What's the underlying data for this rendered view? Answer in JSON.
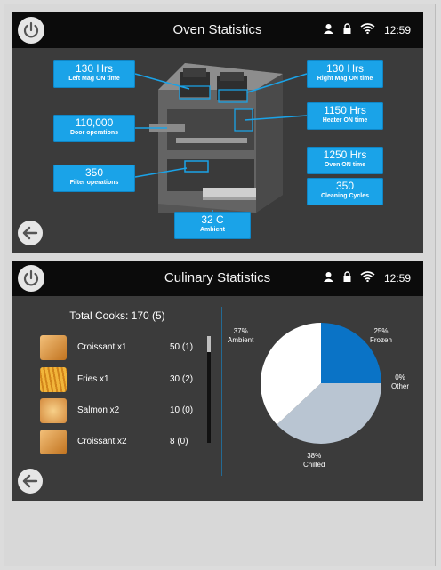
{
  "oven_panel": {
    "title": "Oven Statistics",
    "time": "12:59",
    "stats": {
      "left_mag": {
        "value": "130 Hrs",
        "label": "Left Mag ON time"
      },
      "right_mag": {
        "value": "130 Hrs",
        "label": "Right Mag ON time"
      },
      "door": {
        "value": "110,000",
        "label": "Door operations"
      },
      "heater": {
        "value": "1150 Hrs",
        "label": "Heater ON time"
      },
      "filter": {
        "value": "350",
        "label": "Filter operations"
      },
      "oven_on": {
        "value": "1250 Hrs",
        "label": "Oven ON time"
      },
      "cleaning": {
        "value": "350",
        "label": "Cleaning Cycles"
      },
      "ambient": {
        "value": "32 C",
        "label": "Ambient"
      }
    }
  },
  "culinary_panel": {
    "title": "Culinary Statistics",
    "time": "12:59",
    "total_cooks": "Total Cooks: 170 (5)",
    "items": [
      {
        "name": "Croissant x1",
        "value": "50 (1)"
      },
      {
        "name": "Fries x1",
        "value": "30 (2)"
      },
      {
        "name": "Salmon x2",
        "value": "10 (0)"
      },
      {
        "name": "Croissant x2",
        "value": "8 (0)"
      }
    ],
    "pie": {
      "ambient": {
        "pct": "37%",
        "label": "Ambient",
        "value": 37,
        "color": "#ffffff"
      },
      "frozen": {
        "pct": "25%",
        "label": "Frozen",
        "value": 25,
        "color": "#0a73c6"
      },
      "chilled": {
        "pct": "38%",
        "label": "Chilled",
        "value": 38,
        "color": "#b9c5d2"
      },
      "other": {
        "pct": "0%",
        "label": "Other",
        "value": 0,
        "color": "#6b6b6b"
      }
    }
  },
  "colors": {
    "accent": "#1aa3e8",
    "panel": "#3b3b3b",
    "topbar": "#0b0b0b"
  },
  "icons": [
    "power-icon",
    "user-icon",
    "lock-icon",
    "wifi-icon",
    "back-arrow-icon"
  ]
}
